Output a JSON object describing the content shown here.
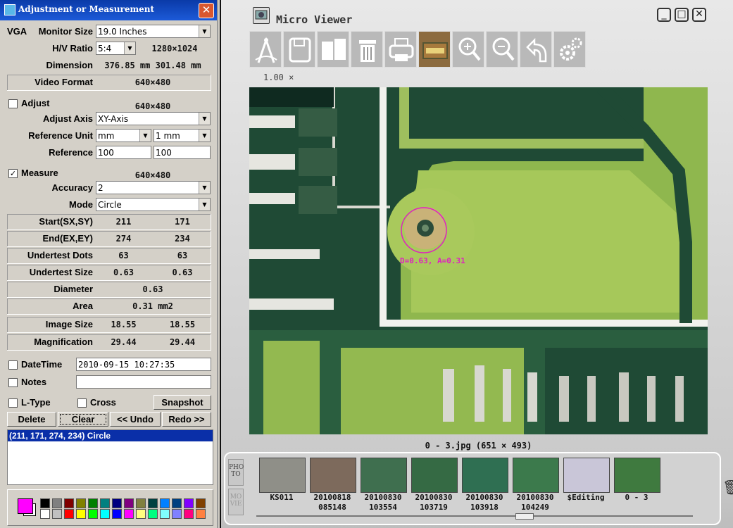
{
  "left_panel": {
    "title": "Adjustment or Measurement",
    "close": "✕",
    "vga_label": "VGA",
    "monitor_size": {
      "label": "Monitor Size",
      "value": "19.0 Inches"
    },
    "hv_ratio": {
      "label": "H/V Ratio",
      "value": "5:4",
      "resolution": "1280×1024"
    },
    "dimension": {
      "label": "Dimension",
      "value": "376.85 mm  301.48 mm"
    },
    "video_format": {
      "label": "Video Format",
      "value": "640×480"
    },
    "adjust": {
      "label": "Adjust",
      "checked": false,
      "value": "640×480"
    },
    "adjust_axis": {
      "label": "Adjust Axis",
      "value": "XY-Axis"
    },
    "reference_unit": {
      "label": "Reference Unit",
      "unit": "mm",
      "step": "1 mm"
    },
    "reference": {
      "label": "Reference",
      "v1": "100",
      "v2": "100"
    },
    "measure": {
      "label": "Measure",
      "checked": true,
      "value": "640×480"
    },
    "accuracy": {
      "label": "Accuracy",
      "value": "2"
    },
    "mode": {
      "label": "Mode",
      "value": "Circle"
    },
    "rows": [
      {
        "label": "Start(SX,SY)",
        "a": "211",
        "b": "171"
      },
      {
        "label": "End(EX,EY)",
        "a": "274",
        "b": "234"
      },
      {
        "label": "Undertest Dots",
        "a": "63",
        "b": "63"
      },
      {
        "label": "Undertest Size",
        "a": "0.63",
        "b": "0.63"
      }
    ],
    "diameter": {
      "label": "Diameter",
      "value": "0.63"
    },
    "area": {
      "label": "Area",
      "value": "0.31 mm2"
    },
    "image_size": {
      "label": "Image Size",
      "a": "18.55",
      "b": "18.55"
    },
    "magnification": {
      "label": "Magnification",
      "a": "29.44",
      "b": "29.44"
    },
    "datetime": {
      "label": "DateTime",
      "checked": false,
      "value": "2010-09-15  10:27:35"
    },
    "notes": {
      "label": "Notes",
      "checked": false,
      "value": ""
    },
    "ltype": {
      "label": "L-Type",
      "checked": false
    },
    "cross": {
      "label": "Cross",
      "checked": false
    },
    "snapshot": "Snapshot",
    "delete": "Delete",
    "clear": "Clear",
    "undo": "<< Undo",
    "redo": "Redo >>",
    "results": [
      "(211, 171, 274, 234) Circle"
    ]
  },
  "palette": {
    "current": "#ff00ff",
    "colors_top": [
      "#000000",
      "#808080",
      "#800000",
      "#808000",
      "#008000",
      "#008080",
      "#000080",
      "#800080",
      "#808040",
      "#004040",
      "#0080ff",
      "#004080",
      "#8000ff",
      "#804000"
    ],
    "colors_bottom": [
      "#ffffff",
      "#c0c0c0",
      "#ff0000",
      "#ffff00",
      "#00ff00",
      "#00ffff",
      "#0000ff",
      "#ff00ff",
      "#ffff80",
      "#00ff80",
      "#80ffff",
      "#8080ff",
      "#ff0080",
      "#ff8040"
    ]
  },
  "viewer": {
    "title": "Micro Viewer",
    "zoom": "1.00 ×",
    "measurement_label": "D=0.63, A=0.31",
    "caption": "0 - 3.jpg (651 × 493)",
    "toolbar_icons": [
      "measure-compass-icon",
      "save-icon",
      "copy-icon",
      "delete-icon",
      "print-icon",
      "ruler-case-icon",
      "zoom-in-icon",
      "zoom-out-icon",
      "undo-arrow-icon",
      "settings-gears-icon"
    ],
    "side_tabs": [
      "PHO TO",
      "MO VIE"
    ],
    "thumbnails": [
      {
        "label": "KS011",
        "color": "#8f8f88"
      },
      {
        "label": "20100818\n085148",
        "color": "#7d6a5c"
      },
      {
        "label": "20100830\n103554",
        "color": "#3f6f4f"
      },
      {
        "label": "20100830\n103719",
        "color": "#356a44"
      },
      {
        "label": "20100830\n103918",
        "color": "#2f6f52"
      },
      {
        "label": "20100830\n104249",
        "color": "#3c7a4c"
      },
      {
        "label": "$Editing",
        "color": "#c9c6d8"
      },
      {
        "label": "0 - 3",
        "color": "#3f7a3f"
      }
    ]
  }
}
